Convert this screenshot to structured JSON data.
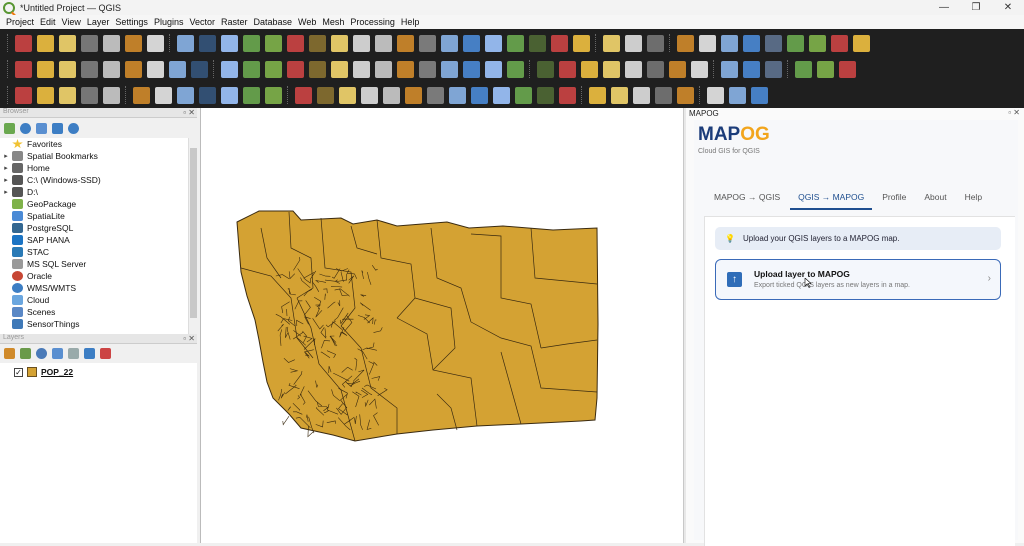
{
  "window": {
    "title": "*Untitled Project — QGIS",
    "minimize_glyph": "—",
    "maximize_glyph": "❐",
    "close_glyph": "✕"
  },
  "menu": [
    "Project",
    "Edit",
    "View",
    "Layer",
    "Settings",
    "Plugins",
    "Vector",
    "Raster",
    "Database",
    "Web",
    "Mesh",
    "Processing",
    "Help"
  ],
  "browser": {
    "title": "Browser",
    "items": [
      {
        "label": "Favorites",
        "icon": "star-icon",
        "expandable": false
      },
      {
        "label": "Spatial Bookmarks",
        "icon": "bookmark-icon",
        "expandable": true
      },
      {
        "label": "Home",
        "icon": "home-folder-icon",
        "expandable": true
      },
      {
        "label": "C:\\ (Windows-SSD)",
        "icon": "drive-icon",
        "expandable": true
      },
      {
        "label": "D:\\",
        "icon": "drive-icon",
        "expandable": true
      },
      {
        "label": "GeoPackage",
        "icon": "geopackage-icon",
        "expandable": false
      },
      {
        "label": "SpatiaLite",
        "icon": "spatialite-icon",
        "expandable": false
      },
      {
        "label": "PostgreSQL",
        "icon": "postgresql-icon",
        "expandable": false
      },
      {
        "label": "SAP HANA",
        "icon": "sap-hana-icon",
        "expandable": false
      },
      {
        "label": "STAC",
        "icon": "stac-icon",
        "expandable": false
      },
      {
        "label": "MS SQL Server",
        "icon": "mssql-icon",
        "expandable": false
      },
      {
        "label": "Oracle",
        "icon": "oracle-icon",
        "expandable": false
      },
      {
        "label": "WMS/WMTS",
        "icon": "wms-globe-icon",
        "expandable": false
      },
      {
        "label": "Cloud",
        "icon": "cloud-icon",
        "expandable": false
      },
      {
        "label": "Scenes",
        "icon": "scenes-icon",
        "expandable": false
      },
      {
        "label": "SensorThings",
        "icon": "sensorthings-icon",
        "expandable": false
      }
    ]
  },
  "layers": {
    "title": "Layers",
    "items": [
      {
        "name": "POP_22",
        "checked": true,
        "color": "#d4a233"
      }
    ]
  },
  "mapog": {
    "panel_title": "MAPOG",
    "logo_main": "MAP",
    "logo_accent": "OG",
    "tagline": "Cloud GIS for QGIS",
    "tabs": [
      {
        "label": "MAPOG → QGIS",
        "active": false
      },
      {
        "label": "QGIS → MAPOG",
        "active": true
      },
      {
        "label": "Profile",
        "active": false
      },
      {
        "label": "About",
        "active": false
      },
      {
        "label": "Help",
        "active": false
      }
    ],
    "notice": "Upload your QGIS layers to a MAPOG map.",
    "upload_title": "Upload layer to MAPOG",
    "upload_subtitle": "Export ticked QGIS layers as new layers in a map.",
    "chevron": "›"
  },
  "colors": {
    "map_fill": "#d4a233",
    "map_stroke": "#3a2a10",
    "toolbar_bg": "#1f1f1f",
    "mapog_blue": "#1b3c7a",
    "mapog_orange": "#f2a51c"
  }
}
